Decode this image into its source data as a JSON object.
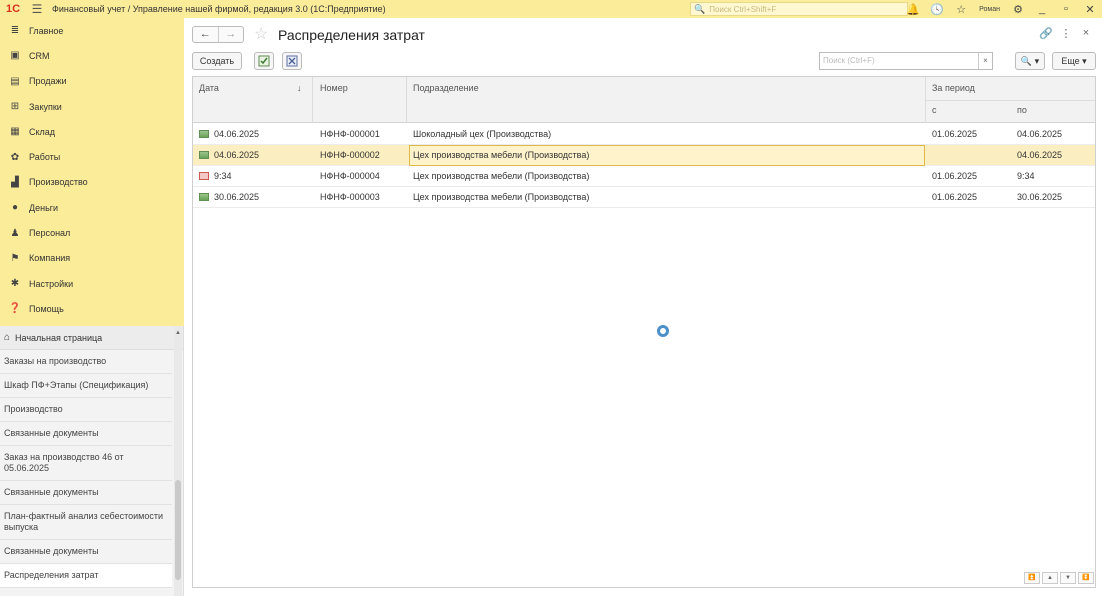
{
  "titlebar": {
    "logo": "1С",
    "title": "Финансовый учет / Управление нашей фирмой, редакция 3.0  (1С:Предприятие)",
    "search_placeholder": "Поиск Ctrl+Shift+F",
    "user": "Роман"
  },
  "sidebar": {
    "items": [
      {
        "label": "Главное",
        "icon": "menu-lines-icon"
      },
      {
        "label": "CRM",
        "icon": "crm-icon"
      },
      {
        "label": "Продажи",
        "icon": "sales-icon"
      },
      {
        "label": "Закупки",
        "icon": "purchases-icon"
      },
      {
        "label": "Склад",
        "icon": "warehouse-icon"
      },
      {
        "label": "Работы",
        "icon": "works-icon"
      },
      {
        "label": "Производство",
        "icon": "production-icon"
      },
      {
        "label": "Деньги",
        "icon": "money-icon"
      },
      {
        "label": "Персонал",
        "icon": "personnel-icon"
      },
      {
        "label": "Компания",
        "icon": "company-flag-icon"
      },
      {
        "label": "Настройки",
        "icon": "settings-gear-icon"
      },
      {
        "label": "Помощь",
        "icon": "help-icon"
      }
    ]
  },
  "open_windows": {
    "home": "Начальная страница",
    "items": [
      "Заказы на производство",
      "Шкаф ПФ+Этапы (Спецификация)",
      "Производство",
      "Связанные документы",
      "Заказ на производство 46 от 05.06.2025",
      "Связанные документы",
      "План-фактный анализ себестоимости выпуска",
      "Связанные документы",
      "Распределения затрат"
    ]
  },
  "main": {
    "title": "Распределения затрат",
    "create_label": "Создать",
    "search_placeholder": "Поиск (Ctrl+F)",
    "search_clear": "×",
    "search_btn": "🔍 ▾",
    "more_label": "Еще ▾"
  },
  "table": {
    "headers": {
      "date": "Дата",
      "sort_mark": "↓",
      "number": "Номер",
      "division": "Подразделение",
      "period": "За период",
      "from": "с",
      "to": "по"
    },
    "rows": [
      {
        "status": "posted",
        "date": "04.06.2025",
        "number": "НФНФ-000001",
        "division": "Шоколадный цех (Производства)",
        "from": "01.06.2025",
        "to": "04.06.2025"
      },
      {
        "status": "posted",
        "date": "04.06.2025",
        "number": "НФНФ-000002",
        "division": "Цех производства мебели (Производства)",
        "from": "",
        "to": "04.06.2025"
      },
      {
        "status": "deleted",
        "date": "9:34",
        "number": "НФНФ-000004",
        "division": "Цех производства мебели (Производства)",
        "from": "01.06.2025",
        "to": "9:34"
      },
      {
        "status": "posted",
        "date": "30.06.2025",
        "number": "НФНФ-000003",
        "division": "Цех производства мебели (Производства)",
        "from": "01.06.2025",
        "to": "30.06.2025"
      }
    ],
    "selected_row": 1
  },
  "colors": {
    "panel_yellow": "#fbec9a",
    "selected_row": "#fbeec0",
    "spinner_blue": "#4a90c8"
  }
}
